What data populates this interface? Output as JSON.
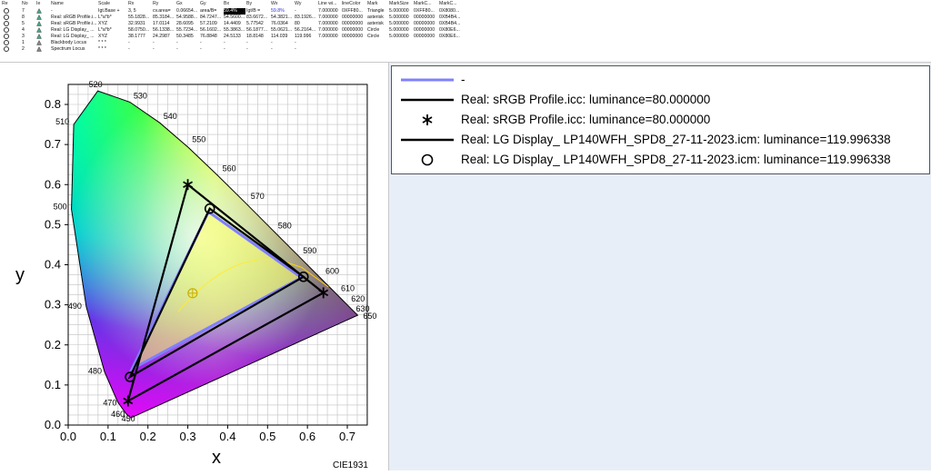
{
  "grid": {
    "headers": [
      "Re",
      "No",
      "Ie",
      "Name",
      "Scale",
      "Rx",
      "Ry",
      "Gx",
      "Gy",
      "Bx",
      "By",
      "Wx",
      "Wy",
      "Line wi...",
      "lineColor",
      "Mark",
      "MarkSize",
      "MarkC...",
      "MarkC..."
    ],
    "rows": [
      {
        "no": "7",
        "icon": "gamut-icon",
        "name": "-",
        "scale": "Igt.Base +",
        "rx": "3, 5",
        "ry": "cv.area=",
        "gx": "0.06654...",
        "gy": "area/B=",
        "bx": "59.4%",
        "by": "Igt/B =",
        "wx": "59.8%",
        "wy": "-",
        "lw": "7.000000",
        "lc": "0XFF80...",
        "mark": "Triangle",
        "ms": "5.000000",
        "mc1": "0XFF80...",
        "mc2": "0X8080..."
      },
      {
        "no": "8",
        "icon": "gamut-icon",
        "name": "Real: sRGB Profile.i...",
        "scale": "L*a*b*",
        "rx": "55.1828...",
        "ry": "85.3184...",
        "gx": "54.9588...",
        "gy": "84.7247...",
        "bx": "54.5600...",
        "by": "83.6672...",
        "wx": "54.3821...",
        "wy": "83.1926...",
        "lw": "7.000000",
        "lc": "00000000",
        "mark": "asterisk",
        "ms": "5.000000",
        "mc1": "00000000",
        "mc2": "0XB4B4..."
      },
      {
        "no": "5",
        "icon": "gamut-icon",
        "name": "Real: sRGB Profile.i...",
        "scale": "XYZ",
        "rx": "32.9931",
        "ry": "17.0114",
        "gx": "28.6095",
        "gy": "57.2109",
        "bx": "14.4409",
        "by": "5.77542",
        "wx": "76.0364",
        "wy": "80",
        "lw": "7.000000",
        "lc": "00000000",
        "mark": "asterisk",
        "ms": "5.000000",
        "mc1": "00000000",
        "mc2": "0XB4B4..."
      },
      {
        "no": "4",
        "icon": "gamut-icon",
        "name": "Real: LG Display_ ...",
        "scale": "L*a*b*",
        "rx": "58.0750...",
        "ry": "56.1338...",
        "gx": "55.7234...",
        "gy": "56.1602...",
        "bx": "55.3863...",
        "by": "56.1877...",
        "wx": "55.0621...",
        "wy": "56.2164...",
        "lw": "7.000000",
        "lc": "00000000",
        "mark": "Circle",
        "ms": "5.000000",
        "mc1": "00000000",
        "mc2": "0X80E6..."
      },
      {
        "no": "3",
        "icon": "gamut-icon",
        "name": "Real: LG Display_ ...",
        "scale": "XYZ",
        "rx": "38.1777",
        "ry": "24.2987",
        "gx": "50.3485",
        "gy": "76.8848",
        "bx": "24.5133",
        "by": "18.8148",
        "wx": "114.039",
        "wy": "119.996",
        "lw": "7.000000",
        "lc": "00000000",
        "mark": "Circle",
        "ms": "5.000000",
        "mc1": "00000000",
        "mc2": "0X80E6..."
      },
      {
        "no": "1",
        "icon": "blackbody-icon",
        "name": "Blackbody Locus",
        "scale": "* * *",
        "rx": "-",
        "ry": "-",
        "gx": "-",
        "gy": "-",
        "bx": "-",
        "by": "-",
        "wx": "-",
        "wy": "-",
        "lw": "",
        "lc": "",
        "mark": "",
        "ms": "",
        "mc1": "",
        "mc2": ""
      },
      {
        "no": "2",
        "icon": "spectrum-icon",
        "name": "Spectrum Locus",
        "scale": "* * *",
        "rx": "-",
        "ry": "-",
        "gx": "-",
        "gy": "-",
        "bx": "-",
        "by": "-",
        "wx": "-",
        "wy": "-",
        "lw": "",
        "lc": "",
        "mark": "",
        "ms": "",
        "mc1": "",
        "mc2": ""
      }
    ]
  },
  "chart_data": {
    "type": "scatter",
    "subtype": "CIE 1931 chromaticity diagram",
    "corner_label": "CIE1931",
    "xlabel": "x",
    "ylabel": "y",
    "xlim": [
      0.0,
      0.75
    ],
    "ylim": [
      0.0,
      0.85
    ],
    "grid": true,
    "xticks": [
      "0.0",
      "0.1",
      "0.2",
      "0.3",
      "0.4",
      "0.5",
      "0.6",
      "0.7"
    ],
    "yticks": [
      "0.0",
      "0.1",
      "0.2",
      "0.3",
      "0.4",
      "0.5",
      "0.6",
      "0.7",
      "0.8"
    ],
    "x_values": [
      0,
      0.1,
      0.2,
      0.3,
      0.4,
      0.5,
      0.6,
      0.7
    ],
    "y_values": [
      0,
      0.1,
      0.2,
      0.3,
      0.4,
      0.5,
      0.6,
      0.7,
      0.8
    ],
    "spectrum_locus": [
      {
        "nm": "450",
        "x": 0.1566,
        "y": 0.0177
      },
      {
        "nm": "460",
        "x": 0.144,
        "y": 0.0297
      },
      {
        "nm": "470",
        "x": 0.1241,
        "y": 0.0578
      },
      {
        "nm": "480",
        "x": 0.0913,
        "y": 0.1327
      },
      {
        "nm": "490",
        "x": 0.0454,
        "y": 0.295
      },
      {
        "nm": "500",
        "x": 0.0082,
        "y": 0.5384
      },
      {
        "nm": "510",
        "x": 0.0139,
        "y": 0.7502
      },
      {
        "nm": "520",
        "x": 0.0743,
        "y": 0.8338
      },
      {
        "nm": "530",
        "x": 0.1547,
        "y": 0.8059
      },
      {
        "nm": "540",
        "x": 0.2296,
        "y": 0.7543
      },
      {
        "nm": "550",
        "x": 0.3016,
        "y": 0.6923
      },
      {
        "nm": "560",
        "x": 0.3731,
        "y": 0.6245
      },
      {
        "nm": "570",
        "x": 0.4441,
        "y": 0.5547
      },
      {
        "nm": "580",
        "x": 0.5125,
        "y": 0.4866
      },
      {
        "nm": "590",
        "x": 0.5752,
        "y": 0.4242
      },
      {
        "nm": "600",
        "x": 0.627,
        "y": 0.3725
      },
      {
        "nm": "610",
        "x": 0.6658,
        "y": 0.334
      },
      {
        "nm": "620",
        "x": 0.6915,
        "y": 0.3083
      },
      {
        "nm": "630",
        "x": 0.7079,
        "y": 0.292
      },
      {
        "nm": "650",
        "x": 0.726,
        "y": 0.274
      }
    ],
    "series": [
      {
        "name": "-",
        "type": "triangle",
        "color": "#8080ff",
        "points": [
          [
            0.64,
            0.33
          ],
          [
            0.3,
            0.6
          ],
          [
            0.15,
            0.06
          ]
        ]
      },
      {
        "name": "Real: sRGB Profile.icc: luminance=80.000000",
        "type": "triangle",
        "color": "#000000",
        "points": [
          [
            0.64,
            0.33
          ],
          [
            0.3,
            0.6
          ],
          [
            0.15,
            0.06
          ]
        ]
      },
      {
        "name": "Real: sRGB Profile.icc: luminance=80.000000",
        "type": "markers",
        "marker": "asterisk",
        "color": "#000000",
        "points": [
          [
            0.64,
            0.33
          ],
          [
            0.3,
            0.6
          ],
          [
            0.15,
            0.06
          ]
        ]
      },
      {
        "name": "Real: LG Display_  LP140WFH_SPD8_27-11-2023.icm: luminance=119.996338",
        "type": "triangle",
        "color": "#000000",
        "points": [
          [
            0.59,
            0.37
          ],
          [
            0.355,
            0.54
          ],
          [
            0.155,
            0.12
          ]
        ]
      },
      {
        "name": "Real: LG Display_  LP140WFH_SPD8_27-11-2023.icm: luminance=119.996338",
        "type": "markers",
        "marker": "circle",
        "color": "#000000",
        "points": [
          [
            0.59,
            0.37
          ],
          [
            0.355,
            0.54
          ],
          [
            0.155,
            0.12
          ]
        ]
      }
    ],
    "blue_gamut": [
      [
        0.585,
        0.368
      ],
      [
        0.352,
        0.532
      ],
      [
        0.16,
        0.14
      ]
    ],
    "white_point": [
      0.312,
      0.329
    ],
    "blackbody_locus": [
      [
        0.6528,
        0.3444
      ],
      [
        0.5857,
        0.3931
      ],
      [
        0.5267,
        0.4133
      ],
      [
        0.477,
        0.4137
      ],
      [
        0.4369,
        0.4041
      ],
      [
        0.4053,
        0.3907
      ],
      [
        0.3805,
        0.3768
      ],
      [
        0.3608,
        0.3636
      ],
      [
        0.3451,
        0.3516
      ],
      [
        0.3324,
        0.341
      ],
      [
        0.3221,
        0.3318
      ],
      [
        0.3135,
        0.3236
      ],
      [
        0.3064,
        0.3165
      ],
      [
        0.2952,
        0.3048
      ],
      [
        0.2869,
        0.2956
      ],
      [
        0.2806,
        0.2883
      ],
      [
        0.2758,
        0.2826
      ]
    ]
  },
  "legend": {
    "items": [
      {
        "label": "-",
        "symbol": "line",
        "color": "#8080ff"
      },
      {
        "label": "Real: sRGB Profile.icc: luminance=80.000000",
        "symbol": "line",
        "color": "#000000"
      },
      {
        "label": "Real: sRGB Profile.icc: luminance=80.000000",
        "symbol": "asterisk",
        "color": "#000000"
      },
      {
        "label": "Real: LG Display_  LP140WFH_SPD8_27-11-2023.icm: luminance=119.996338",
        "symbol": "line",
        "color": "#000000"
      },
      {
        "label": "Real: LG Display_  LP140WFH_SPD8_27-11-2023.icm: luminance=119.996338",
        "symbol": "circle",
        "color": "#000000"
      }
    ]
  }
}
